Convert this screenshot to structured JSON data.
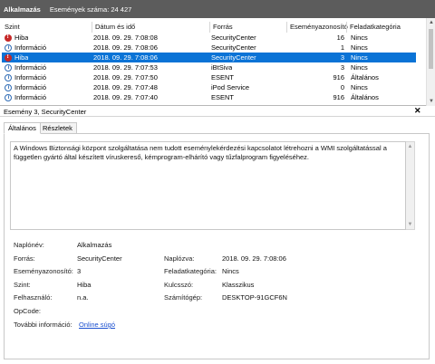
{
  "header": {
    "title": "Alkalmazás",
    "count_text": "Események száma: 24 427"
  },
  "table": {
    "columns": [
      "Szint",
      "Dátum és idő",
      "Forrás",
      "Eseményazonosító",
      "Feladatkategória"
    ],
    "rows": [
      {
        "level": "Hiba",
        "icon": "error-icon",
        "datetime": "2018. 09. 29. 7:08:08",
        "source": "SecurityCenter",
        "event_id": "16",
        "category": "Nincs",
        "selected": false
      },
      {
        "level": "Információ",
        "icon": "info-icon",
        "datetime": "2018. 09. 29. 7:08:06",
        "source": "SecurityCenter",
        "event_id": "1",
        "category": "Nincs",
        "selected": false
      },
      {
        "level": "Hiba",
        "icon": "error-icon",
        "datetime": "2018. 09. 29. 7:08:06",
        "source": "SecurityCenter",
        "event_id": "3",
        "category": "Nincs",
        "selected": true
      },
      {
        "level": "Információ",
        "icon": "info-icon",
        "datetime": "2018. 09. 29. 7:07:53",
        "source": "iBtSiva",
        "event_id": "3",
        "category": "Nincs",
        "selected": false
      },
      {
        "level": "Információ",
        "icon": "info-icon",
        "datetime": "2018. 09. 29. 7:07:50",
        "source": "ESENT",
        "event_id": "916",
        "category": "Általános",
        "selected": false
      },
      {
        "level": "Információ",
        "icon": "info-icon",
        "datetime": "2018. 09. 29. 7:07:48",
        "source": "iPod Service",
        "event_id": "0",
        "category": "Nincs",
        "selected": false
      },
      {
        "level": "Információ",
        "icon": "info-icon",
        "datetime": "2018. 09. 29. 7:07:40",
        "source": "ESENT",
        "event_id": "916",
        "category": "Általános",
        "selected": false
      }
    ]
  },
  "detail": {
    "title": "Esemény 3, SecurityCenter",
    "close_icon": "close-icon",
    "tabs": [
      "Általános",
      "Részletek"
    ],
    "description": "A Windows Biztonsági központ szolgáltatása nem tudott eseménylekérdezési kapcsolatot létrehozni a WMI szolgáltatással a független gyártó által készített víruskereső, kémprogram-elhárító vagy tűzfalprogram figyeléséhez.",
    "labels": {
      "log_name": "Naplónév:",
      "source": "Forrás:",
      "event_id": "Eseményazonosító:",
      "level": "Szint:",
      "user": "Felhasználó:",
      "opcode": "OpCode:",
      "more_info": "További információ:",
      "logged": "Naplózva:",
      "task_category": "Feladatkategória:",
      "keywords": "Kulcsszó:",
      "computer": "Számítógép:"
    },
    "values": {
      "log_name": "Alkalmazás",
      "source": "SecurityCenter",
      "event_id": "3",
      "level": "Hiba",
      "user": "n.a.",
      "opcode": "",
      "more_info": "Online súgó",
      "logged": "2018. 09. 29. 7:08:06",
      "task_category": "Nincs",
      "keywords": "Klasszikus",
      "computer": "DESKTOP-91GCF6N"
    }
  },
  "colors": {
    "header_bg": "#5c5c5c",
    "selection": "#0a73d6",
    "error": "#c62828",
    "info": "#2e6bb5",
    "link": "#1a4fd0"
  }
}
